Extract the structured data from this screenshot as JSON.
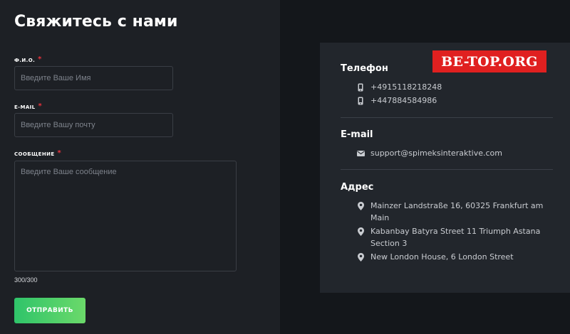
{
  "form": {
    "title": "Свяжитесь с нами",
    "required_mark": "*",
    "name_label": "Ф.И.О.",
    "name_placeholder": "Введите Ваше Имя",
    "email_label": "E-MAIL",
    "email_placeholder": "Введите Вашу почту",
    "message_label": "СООБЩЕНИЕ",
    "message_placeholder": "Введите Ваше сообщение",
    "char_counter": "300/300",
    "submit_label": "ОТПРАВИТЬ"
  },
  "watermark": "BE-TOP.ORG",
  "contacts": {
    "phone_title": "Телефон",
    "phones": [
      "+4915118218248",
      "+447884584986"
    ],
    "email_title": "E-mail",
    "email": "support@spimeksinteraktive.com",
    "address_title": "Адрес",
    "addresses": [
      "Mainzer Landstraße 16, 60325 Frankfurt am Main",
      "Kabanbay Batyra Street 11 Triumph Astana Section 3",
      "New London House, 6 London Street"
    ]
  },
  "icons": {
    "phone": "phone-icon",
    "email": "envelope-icon",
    "address": "map-pin-icon"
  },
  "colors": {
    "required": "#e8323c",
    "submit_gradient_start": "#2fc46a",
    "submit_gradient_end": "#6bd96a",
    "watermark_bg": "#e02020"
  }
}
